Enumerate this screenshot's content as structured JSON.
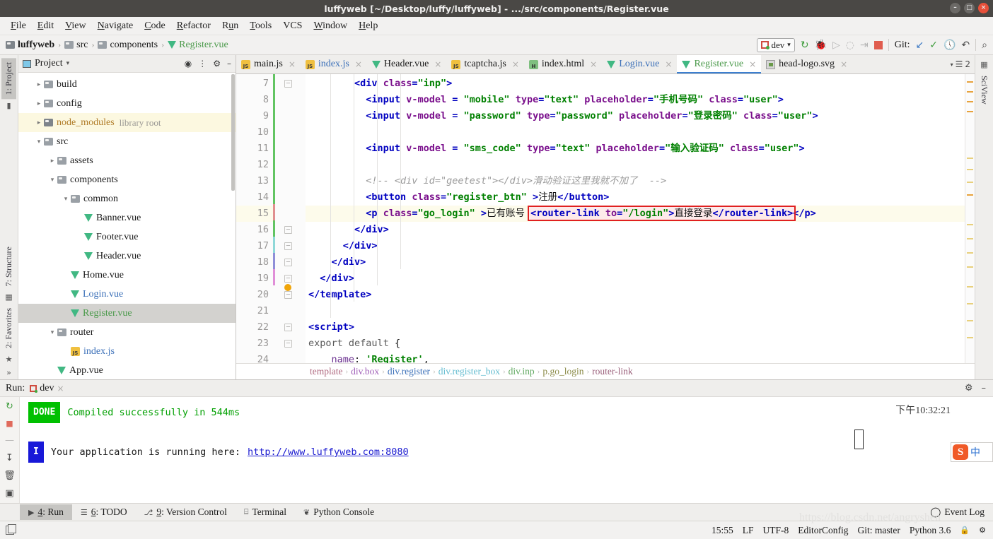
{
  "window": {
    "title": "luffyweb [~/Desktop/luffy/luffyweb] - .../src/components/Register.vue",
    "minimize": "–",
    "maximize": "□",
    "close": "×"
  },
  "menu": {
    "items": [
      "File",
      "Edit",
      "View",
      "Navigate",
      "Code",
      "Refactor",
      "Run",
      "Tools",
      "VCS",
      "Window",
      "Help"
    ]
  },
  "breadcrumb": {
    "items": [
      "luffyweb",
      "src",
      "components",
      "Register.vue"
    ],
    "separator": "›"
  },
  "toolbar": {
    "run_config": "dev",
    "dropdown_caret": "▾",
    "git_label": "Git:",
    "icons": [
      "run-icon",
      "debug-icon",
      "coverage-icon",
      "profile-icon",
      "run-with-args-icon",
      "stop-icon"
    ],
    "git_icons": [
      "update-project-icon",
      "commit-icon",
      "history-icon",
      "rollback-icon"
    ],
    "search_icon": "⌕"
  },
  "left_rail": {
    "tabs": [
      "1: Project",
      "7: Structure",
      "2: Favorites"
    ]
  },
  "right_rail": {
    "tabs": [
      "SciView"
    ]
  },
  "project": {
    "title": "Project",
    "caret": "▾",
    "controls": [
      "locate-icon",
      "collapse-all-icon",
      "settings-icon",
      "hide-icon"
    ],
    "tree": [
      {
        "label": "build",
        "arrow": "▸",
        "indent": 1,
        "kind": "folder",
        "state": "normal"
      },
      {
        "label": "config",
        "arrow": "▸",
        "indent": 1,
        "kind": "folder",
        "state": "normal"
      },
      {
        "label": "node_modules",
        "arrow": "▸",
        "indent": 1,
        "kind": "folder-dark",
        "state": "yellow",
        "suffix": "library root",
        "color": "orange"
      },
      {
        "label": "src",
        "arrow": "▾",
        "indent": 1,
        "kind": "folder",
        "state": "normal"
      },
      {
        "label": "assets",
        "arrow": "▸",
        "indent": 2,
        "kind": "folder",
        "state": "normal"
      },
      {
        "label": "components",
        "arrow": "▾",
        "indent": 2,
        "kind": "folder",
        "state": "normal"
      },
      {
        "label": "common",
        "arrow": "▾",
        "indent": 3,
        "kind": "folder",
        "state": "normal"
      },
      {
        "label": "Banner.vue",
        "arrow": "",
        "indent": 4,
        "kind": "vue",
        "state": "normal"
      },
      {
        "label": "Footer.vue",
        "arrow": "",
        "indent": 4,
        "kind": "vue",
        "state": "normal"
      },
      {
        "label": "Header.vue",
        "arrow": "",
        "indent": 4,
        "kind": "vue",
        "state": "normal"
      },
      {
        "label": "Home.vue",
        "arrow": "",
        "indent": 3,
        "kind": "vue",
        "state": "normal"
      },
      {
        "label": "Login.vue",
        "arrow": "",
        "indent": 3,
        "kind": "vue",
        "state": "normal",
        "color": "blue"
      },
      {
        "label": "Register.vue",
        "arrow": "",
        "indent": 3,
        "kind": "vue",
        "state": "selected",
        "color": "green"
      },
      {
        "label": "router",
        "arrow": "▾",
        "indent": 2,
        "kind": "folder",
        "state": "normal"
      },
      {
        "label": "index.js",
        "arrow": "",
        "indent": 3,
        "kind": "js",
        "state": "normal",
        "color": "blue"
      },
      {
        "label": "App.vue",
        "arrow": "",
        "indent": 2,
        "kind": "vue",
        "state": "normal"
      }
    ]
  },
  "editor_tabs": [
    {
      "label": "main.js",
      "icon": "js-file-icon",
      "active": false,
      "color": "normal"
    },
    {
      "label": "index.js",
      "icon": "js-file-icon",
      "active": false,
      "color": "blue"
    },
    {
      "label": "Header.vue",
      "icon": "vue-file-icon",
      "active": false,
      "color": "normal"
    },
    {
      "label": "tcaptcha.js",
      "icon": "js-file-icon",
      "active": false,
      "color": "normal"
    },
    {
      "label": "index.html",
      "icon": "html-file-icon",
      "active": false,
      "color": "normal"
    },
    {
      "label": "Login.vue",
      "icon": "vue-file-icon",
      "active": false,
      "color": "blue"
    },
    {
      "label": "Register.vue",
      "icon": "vue-file-icon",
      "active": true,
      "color": "green"
    },
    {
      "label": "head-logo.svg",
      "icon": "svg-file-icon",
      "active": false,
      "color": "normal"
    }
  ],
  "editor_tabs_overflow": "2",
  "code": {
    "first_line": 7,
    "lines": [
      {
        "n": 7,
        "text": "        <div class=\"inp\">"
      },
      {
        "n": 8,
        "text": "          <input v-model = \"mobile\" type=\"text\" placeholder=\"手机号码\" class=\"user\">"
      },
      {
        "n": 9,
        "text": "          <input v-model = \"password\" type=\"password\" placeholder=\"登录密码\" class=\"user\">"
      },
      {
        "n": 10,
        "text": ""
      },
      {
        "n": 11,
        "text": "          <input v-model = \"sms_code\" type=\"text\" placeholder=\"输入验证码\" class=\"user\">"
      },
      {
        "n": 12,
        "text": ""
      },
      {
        "n": 13,
        "text": "          <!-- <div id=\"geetest\"></div>滑动验证这里我就不加了  -->"
      },
      {
        "n": 14,
        "text": "          <button class=\"register_btn\" >注册</button>"
      },
      {
        "n": 15,
        "text": "          <p class=\"go_login\" >已有账号 <router-link to=\"/login\">直接登录</router-link></p>"
      },
      {
        "n": 16,
        "text": "        </div>"
      },
      {
        "n": 17,
        "text": "      </div>"
      },
      {
        "n": 18,
        "text": "    </div>"
      },
      {
        "n": 19,
        "text": "  </div>"
      },
      {
        "n": 20,
        "text": "</template>"
      },
      {
        "n": 21,
        "text": ""
      },
      {
        "n": 22,
        "text": "<script>"
      },
      {
        "n": 23,
        "text": "export default {"
      },
      {
        "n": 24,
        "text": "    name: 'Register',"
      }
    ]
  },
  "editor_breadcrumb": {
    "items": [
      "template",
      "div.box",
      "div.register",
      "div.register_box",
      "div.inp",
      "p.go_login",
      "router-link"
    ],
    "separator": "›"
  },
  "run_panel": {
    "label": "Run:",
    "config": "dev",
    "close": "×",
    "settings_icon": "gear-icon",
    "hide_icon": "hide-icon",
    "rail_icons": [
      "rerun-icon",
      "stop-icon",
      "scroll-to-end-icon",
      "trash-icon"
    ],
    "output": [
      {
        "badge": "DONE",
        "badge_kind": "done",
        "text": "Compiled successfully in 544ms"
      },
      {
        "badge": "I",
        "badge_kind": "info",
        "text": "Your application is running here:",
        "link": "http://www.luffyweb.com:8080"
      }
    ],
    "timestamp": "下午10:32:21",
    "ime": {
      "logo": "S",
      "mode": "中"
    }
  },
  "tool_windows": {
    "items": [
      {
        "label": "4: Run",
        "icon": "run-icon",
        "active": true
      },
      {
        "label": "6: TODO",
        "icon": "todo-icon",
        "active": false
      },
      {
        "label": "9: Version Control",
        "icon": "branch-icon",
        "active": false
      },
      {
        "label": "Terminal",
        "icon": "terminal-icon",
        "active": false
      },
      {
        "label": "Python Console",
        "icon": "python-icon",
        "active": false
      }
    ],
    "event_log": "Event Log",
    "event_log_icon": "balloon-icon"
  },
  "statusbar": {
    "left_icon": "copy-icon",
    "items": [
      "15:55",
      "LF",
      "UTF-8",
      "EditorConfig",
      "Git: master",
      "Python 3.6"
    ],
    "watermark": "https://blog.csdn.net/angryshen",
    "icons": [
      "lock-icon",
      "memory-icon"
    ]
  }
}
